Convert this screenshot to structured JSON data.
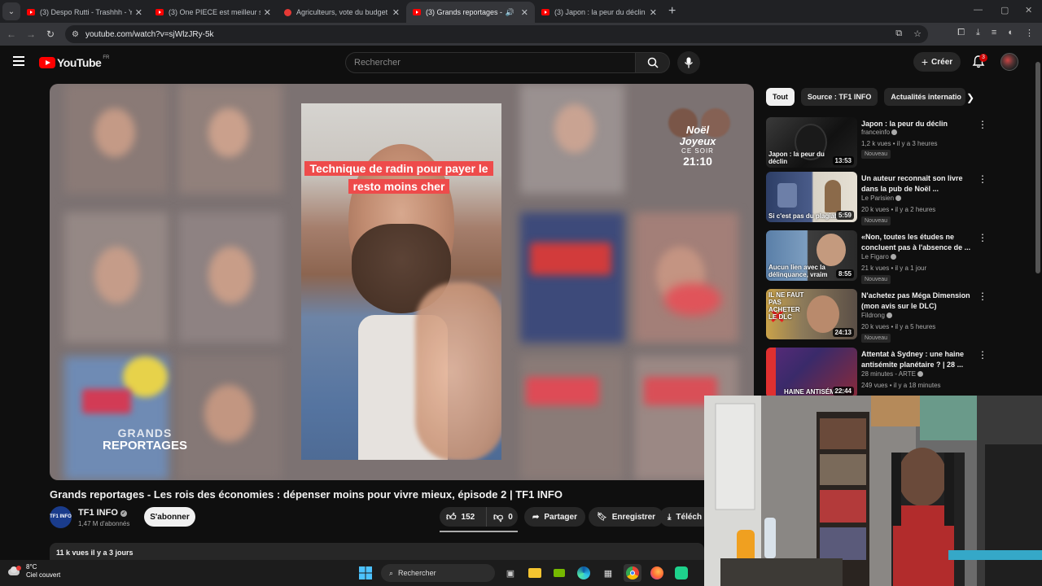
{
  "browser": {
    "tabs": [
      {
        "title": "(3) Despo Rutti - Trashhh - YouTube",
        "active": false,
        "icon": "youtube-icon"
      },
      {
        "title": "(3) One PIECE est meilleur sans ...",
        "active": false,
        "icon": "youtube-icon"
      },
      {
        "title": "Agriculteurs, vote du budget",
        "active": false,
        "icon": "news-icon"
      },
      {
        "title": "(3) Grands reportages - Les ro",
        "active": true,
        "icon": "youtube-icon"
      },
      {
        "title": "(3) Japon : la peur du déclin - YouTube",
        "active": false,
        "icon": "youtube-icon"
      }
    ],
    "url": "youtube.com/watch?v=sjWlzJRy-5k"
  },
  "youtube": {
    "logo_text": "YouTube",
    "country_code": "FR",
    "search_placeholder": "Rechercher",
    "create_label": "Créer",
    "notif_count": "3"
  },
  "video": {
    "caption": "Technique de radin pour payer le resto moins cher",
    "brand_line1": "GRANDS",
    "brand_line2": "REPORTAGES",
    "promo_line1": "Noël",
    "promo_line2": "Joyeux",
    "promo_line3": "CE SOIR",
    "promo_time": "21:10",
    "title": "Grands reportages - Les rois des économies : dépenser moins pour vivre mieux, épisode 2 | TF1 INFO",
    "channel_name": "TF1 INFO",
    "channel_avatar_text": "TF1 INFO",
    "subscribers": "1,47 M d'abonnés",
    "subscribe_label": "S'abonner",
    "likes": "152",
    "dislikes": "0",
    "share_label": "Partager",
    "save_label": "Enregistrer",
    "download_label": "Téléch",
    "views_date": "11 k vues  il y a 3 jours"
  },
  "sidebar": {
    "chips": [
      "Tout",
      "Source : TF1 INFO",
      "Actualités internatio"
    ],
    "recommendations": [
      {
        "title": "Japon : la peur du déclin",
        "channel": "franceinfo",
        "meta": "1,2 k vues • il y a 3 heures",
        "badge": "Nouveau",
        "duration": "13:53",
        "thumb_text": "Japon : la peur du déclin"
      },
      {
        "title": "Un auteur reconnaît son livre dans la pub de Noël ...",
        "channel": "Le Parisien",
        "meta": "20 k vues • il y a 2 heures",
        "badge": "Nouveau",
        "duration": "5:59",
        "thumb_text": "Si c'est pas du plagiat"
      },
      {
        "title": "«Non, toutes les études ne concluent pas à l'absence de ...",
        "channel": "Le Figaro",
        "meta": "21 k vues • il y a 1 jour",
        "badge": "Nouveau",
        "duration": "8:55",
        "thumb_text": "Aucun lien avec la délinquance, vraim"
      },
      {
        "title": "N'achetez pas Méga Dimension (mon avis sur le DLC)",
        "channel": "Fildrong",
        "meta": "20 k vues • il y a 5 heures",
        "badge": "Nouveau",
        "duration": "24:13",
        "thumb_text": "IL NE FAUT PAS ACHETER LE DLC"
      },
      {
        "title": "Attentat à Sydney : une haine antisémite planétaire ? | 28 ...",
        "channel": "28 minutes - ARTE",
        "meta": "249 vues • il y a 18 minutes",
        "badge": "",
        "duration": "22:44",
        "thumb_text": "HAINE ANTISÉMITE"
      }
    ]
  },
  "taskbar": {
    "temperature": "8°C",
    "weather": "Ciel couvert",
    "search_label": "Rechercher"
  },
  "colors": {
    "bg": "#0f0f0f",
    "accent_red": "#ff0000",
    "caption_red": "#ee4b4b"
  }
}
